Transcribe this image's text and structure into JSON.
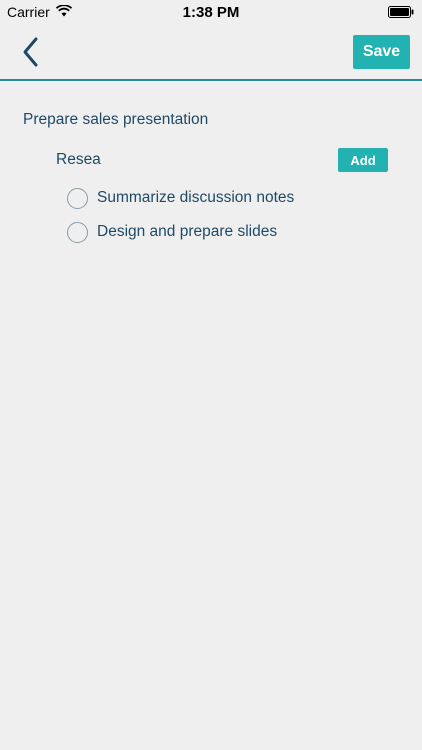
{
  "status_bar": {
    "carrier": "Carrier",
    "time": "1:38 PM",
    "wifi_icon": "wifi-icon",
    "battery_icon": "battery-icon"
  },
  "nav": {
    "back_icon": "chevron-left-icon",
    "save_label": "Save"
  },
  "task": {
    "title": "Prepare sales presentation",
    "subtask_input_value": "Resea",
    "add_label": "Add",
    "checklist": [
      {
        "label": "Summarize discussion notes"
      },
      {
        "label": "Design and prepare slides"
      }
    ]
  },
  "colors": {
    "accent": "#22b2b1",
    "text": "#1f4a66",
    "divider": "#2a8a9c",
    "background": "#efefef"
  }
}
